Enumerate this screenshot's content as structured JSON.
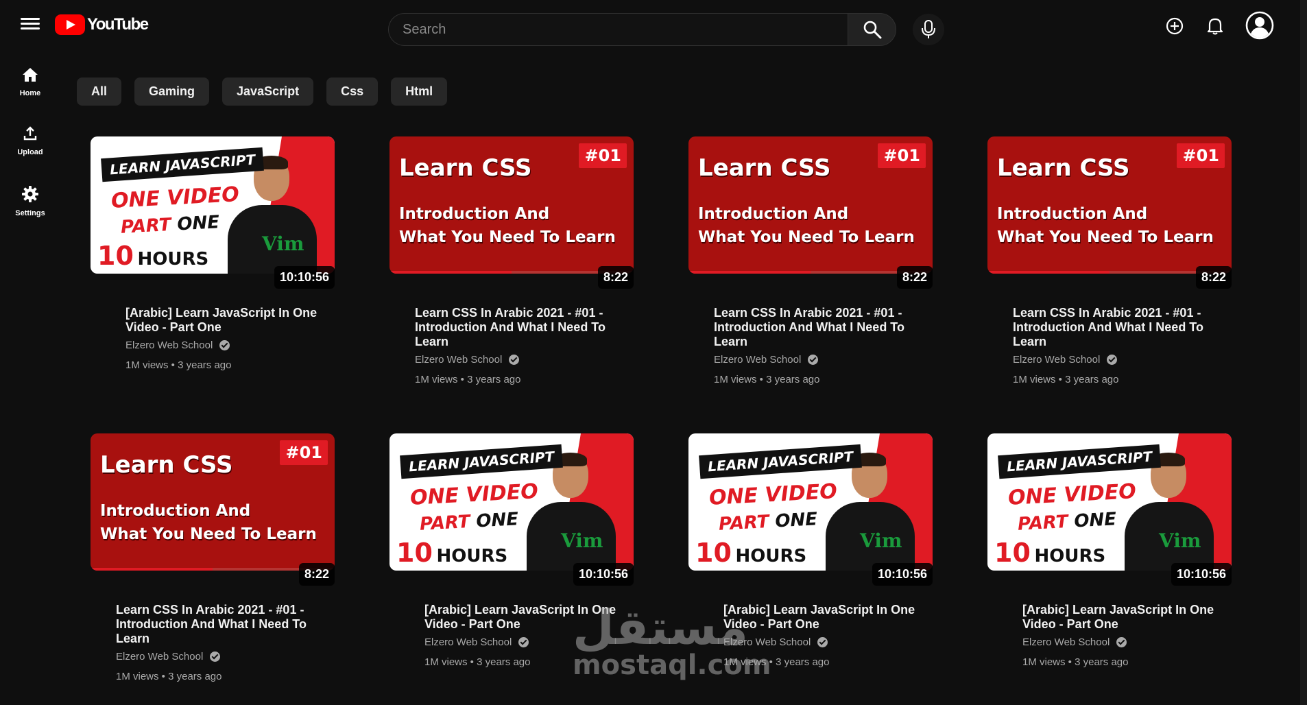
{
  "app": {
    "logo_text": "YouTube"
  },
  "search": {
    "placeholder": "Search"
  },
  "sidebar": {
    "items": [
      {
        "label": "Home",
        "icon": "home-icon"
      },
      {
        "label": "Upload",
        "icon": "upload-icon"
      },
      {
        "label": "Settings",
        "icon": "gear-icon"
      }
    ]
  },
  "chips": [
    "All",
    "Gaming",
    "JavaScript",
    "Css",
    "Html"
  ],
  "colors": {
    "background": "#0f0f0f",
    "chip": "#272727",
    "brand_red": "#ff0000",
    "thumb_red": "#a8110f"
  },
  "thumbnails": {
    "js": {
      "banner": "LEARN JAVASCRIPT",
      "line1": "ONE VIDEO",
      "part_a": "PART",
      "part_b": "ONE",
      "hours_n": "10",
      "hours_w": "HOURS",
      "logo": "Vim"
    },
    "css": {
      "title": "Learn CSS",
      "badge": "#01",
      "line1": "Introduction And",
      "line2": "What You Need To Learn",
      "progress": 0.5
    }
  },
  "videos": [
    {
      "thumb": "js",
      "duration": "10:10:56",
      "title": "[Arabic] Learn JavaScript In One Video - Part One",
      "channel": "Elzero Web School",
      "stats": "1M views • 3 years ago"
    },
    {
      "thumb": "css",
      "duration": "8:22",
      "title": "Learn CSS In Arabic 2021 - #01 - Introduction And What I Need To Learn",
      "channel": "Elzero Web School",
      "stats": "1M views • 3 years ago"
    },
    {
      "thumb": "css",
      "duration": "8:22",
      "title": "Learn CSS In Arabic 2021 - #01 - Introduction And What I Need To Learn",
      "channel": "Elzero Web School",
      "stats": "1M views • 3 years ago"
    },
    {
      "thumb": "css",
      "duration": "8:22",
      "title": "Learn CSS In Arabic 2021 - #01 - Introduction And What I Need To Learn",
      "channel": "Elzero Web School",
      "stats": "1M views • 3 years ago"
    },
    {
      "thumb": "css",
      "duration": "8:22",
      "title": "Learn CSS In Arabic 2021 - #01 - Introduction And What I Need To Learn",
      "channel": "Elzero Web School",
      "stats": "1M views • 3 years ago"
    },
    {
      "thumb": "js",
      "duration": "10:10:56",
      "title": "[Arabic] Learn JavaScript In One Video - Part One",
      "channel": "Elzero Web School",
      "stats": "1M views • 3 years ago"
    },
    {
      "thumb": "js",
      "duration": "10:10:56",
      "title": "[Arabic] Learn JavaScript In One Video - Part One",
      "channel": "Elzero Web School",
      "stats": "1M views • 3 years ago"
    },
    {
      "thumb": "js",
      "duration": "10:10:56",
      "title": "[Arabic] Learn JavaScript In One Video - Part One",
      "channel": "Elzero Web School",
      "stats": "1M views • 3 years ago"
    }
  ],
  "watermark": {
    "arabic": "مستقل",
    "latin": "mostaql.com"
  }
}
